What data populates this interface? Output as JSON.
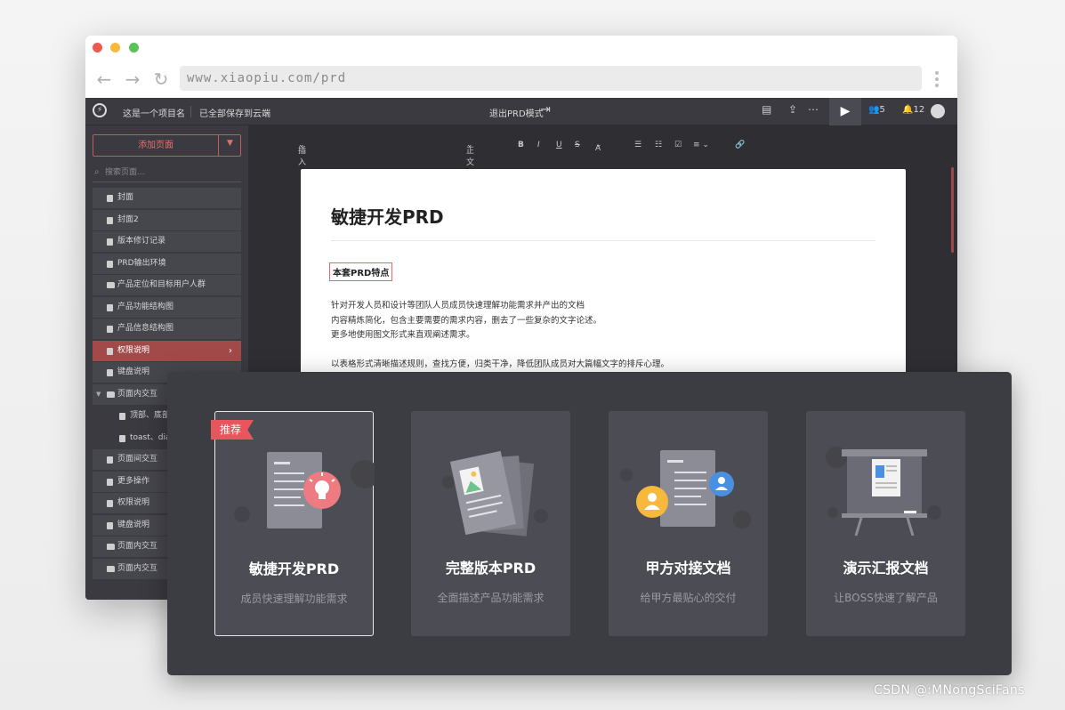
{
  "browser": {
    "url": "www.xiaopiu.com/prd",
    "back": "←",
    "forward": "→",
    "reload": "↻"
  },
  "appbar": {
    "project_name": "这是一个项目名",
    "save_status": "已全部保存到云端",
    "exit_mode": "退出PRD模式",
    "collaborators": "5",
    "notifications": "12"
  },
  "sidebar": {
    "add_page": "添加页面",
    "search_placeholder": "搜索页面...",
    "items": [
      {
        "label": "封面",
        "type": "page"
      },
      {
        "label": "封面2",
        "type": "page"
      },
      {
        "label": "版本修订记录",
        "type": "page"
      },
      {
        "label": "PRD输出环境",
        "type": "page"
      },
      {
        "label": "产品定位和目标用户人群",
        "type": "folder"
      },
      {
        "label": "产品功能结构图",
        "type": "page"
      },
      {
        "label": "产品信息结构图",
        "type": "page"
      },
      {
        "label": "权限说明",
        "type": "page",
        "active": true
      },
      {
        "label": "键盘说明",
        "type": "page"
      },
      {
        "label": "页面内交互",
        "type": "folder"
      },
      {
        "label": "顶部、底部",
        "type": "child"
      },
      {
        "label": "toast、dia",
        "type": "child"
      },
      {
        "label": "页面间交互",
        "type": "page"
      },
      {
        "label": "更多操作",
        "type": "page"
      },
      {
        "label": "权限说明",
        "type": "page"
      },
      {
        "label": "键盘说明",
        "type": "page"
      },
      {
        "label": "页面内交互",
        "type": "folder"
      },
      {
        "label": "页面内交互",
        "type": "folder"
      }
    ]
  },
  "format_bar": {
    "insert": "插入",
    "text_style": "正文",
    "bold": "B",
    "italic": "I",
    "underline": "U",
    "strike": "S",
    "font_color": "A"
  },
  "document": {
    "title": "敏捷开发PRD",
    "subtitle": "本套PRD特点",
    "lines": [
      "针对开发人员和设计等团队人员成员快速理解功能需求并产出的文档",
      "内容精炼简化，包含主要需要的需求内容，删去了一些复杂的文字论述。",
      "更多地使用图文形式来直观阐述需求。",
      "以表格形式清晰描述规则，查找方便，归类干净，降低团队成员对大篇幅文字的排斥心理。"
    ]
  },
  "templates": {
    "recommend_badge": "推荐",
    "cards": [
      {
        "title": "敏捷开发PRD",
        "desc": "成员快速理解功能需求"
      },
      {
        "title": "完整版本PRD",
        "desc": "全面描述产品功能需求"
      },
      {
        "title": "甲方对接文档",
        "desc": "给甲方最贴心的交付"
      },
      {
        "title": "演示汇报文档",
        "desc": "让BOSS快速了解产品"
      }
    ]
  },
  "watermark": "CSDN @:MNongSciFans",
  "colors": {
    "accent": "#e9555c",
    "active_item": "#a24a4a",
    "panel": "#3c3c43",
    "card": "#4c4c54"
  }
}
